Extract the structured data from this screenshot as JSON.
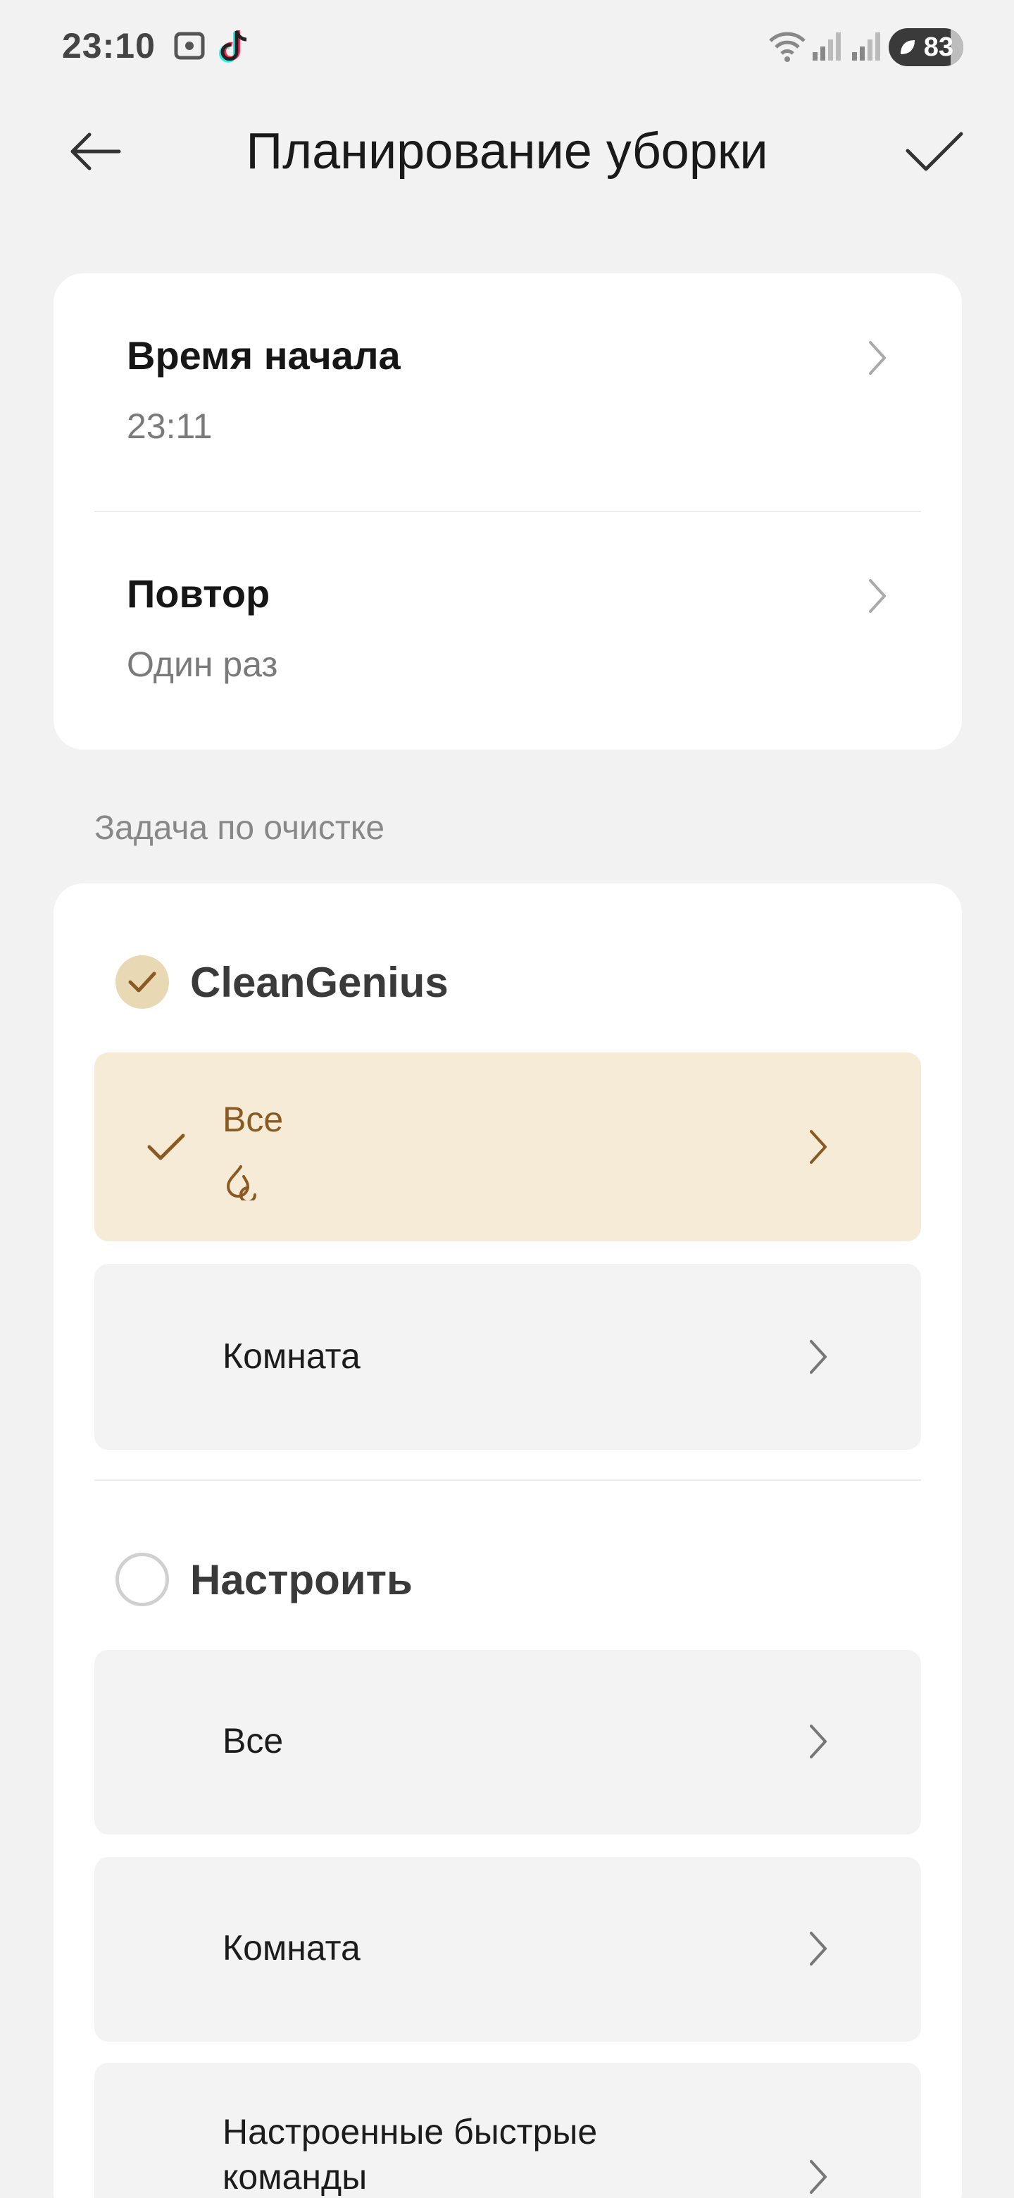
{
  "status_bar": {
    "time": "23:10",
    "icons": [
      "screenshot-icon",
      "tiktok-icon",
      "wifi-icon",
      "signal-icon",
      "signal-icon"
    ],
    "battery_level": "83"
  },
  "header": {
    "title": "Планирование уборки",
    "back_icon": "arrow-left-icon",
    "confirm_icon": "check-icon"
  },
  "schedule": {
    "start_time": {
      "label": "Время начала",
      "value": "23:11"
    },
    "repeat": {
      "label": "Повтор",
      "value": "Один раз"
    }
  },
  "task_section_label": "Задача по очистке",
  "clean_genius": {
    "label": "CleanGenius",
    "checked": true,
    "options": [
      {
        "label": "Все",
        "selected": true,
        "sub_icon": "clean-mode-icon"
      },
      {
        "label": "Комната",
        "selected": false
      }
    ]
  },
  "custom": {
    "label": "Настроить",
    "checked": false,
    "options": [
      {
        "label": "Все"
      },
      {
        "label": "Комната"
      },
      {
        "label": "Настроенные быстрые команды"
      }
    ]
  },
  "colors": {
    "accent": "#8a5a22",
    "accent_bg": "#f5ebd6",
    "radio_checked_bg": "#e8d9b4",
    "page_bg": "#f2f2f2",
    "card_bg": "#ffffff"
  }
}
